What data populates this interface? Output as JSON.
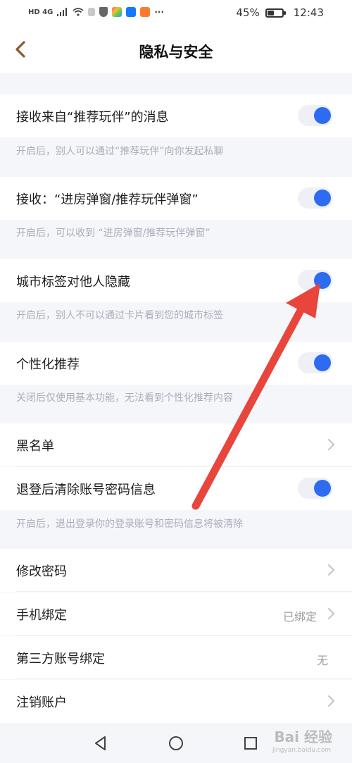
{
  "status_bar": {
    "network": "HD 4G",
    "battery_text": "45%",
    "battery_level": 0.45,
    "time": "12:43",
    "dots": "···"
  },
  "header": {
    "title": "隐私与安全"
  },
  "settings": {
    "recommend_msg": {
      "label": "接收来自“推荐玩伴”的消息",
      "enabled": true,
      "desc": "开启后，别人可以通过“推荐玩伴”向你发起私聊"
    },
    "popup": {
      "label": "接收：“进房弹窗/推荐玩伴弹窗”",
      "enabled": true,
      "desc": "开启后，可以收到 “进房弹窗/推荐玩伴弹窗”"
    },
    "city_tag": {
      "label": "城市标签对他人隐藏",
      "enabled": true,
      "desc": "开启后，别人不可以通过卡片看到您的城市标签"
    },
    "personalized": {
      "label": "个性化推荐",
      "enabled": true,
      "desc": "关闭后仅使用基本功能，无法看到个性化推荐内容"
    },
    "blacklist": {
      "label": "黑名单"
    },
    "clear_on_logout": {
      "label": "退登后清除账号密码信息",
      "enabled": true,
      "desc": "开启后，退出登录你的登录账号和密码信息将被清除"
    },
    "change_password": {
      "label": "修改密码"
    },
    "phone_binding": {
      "label": "手机绑定",
      "value": "已绑定"
    },
    "third_party": {
      "label": "第三方账号绑定",
      "value": "无"
    },
    "cancel_account": {
      "label": "注销账户"
    }
  },
  "watermark": {
    "text": "Bai 经验",
    "sub": "jingyan.baidu.com"
  },
  "colors": {
    "accent": "#2d6cf0",
    "annotation_arrow": "#e8453c",
    "back_arrow": "#8a5a2b"
  }
}
